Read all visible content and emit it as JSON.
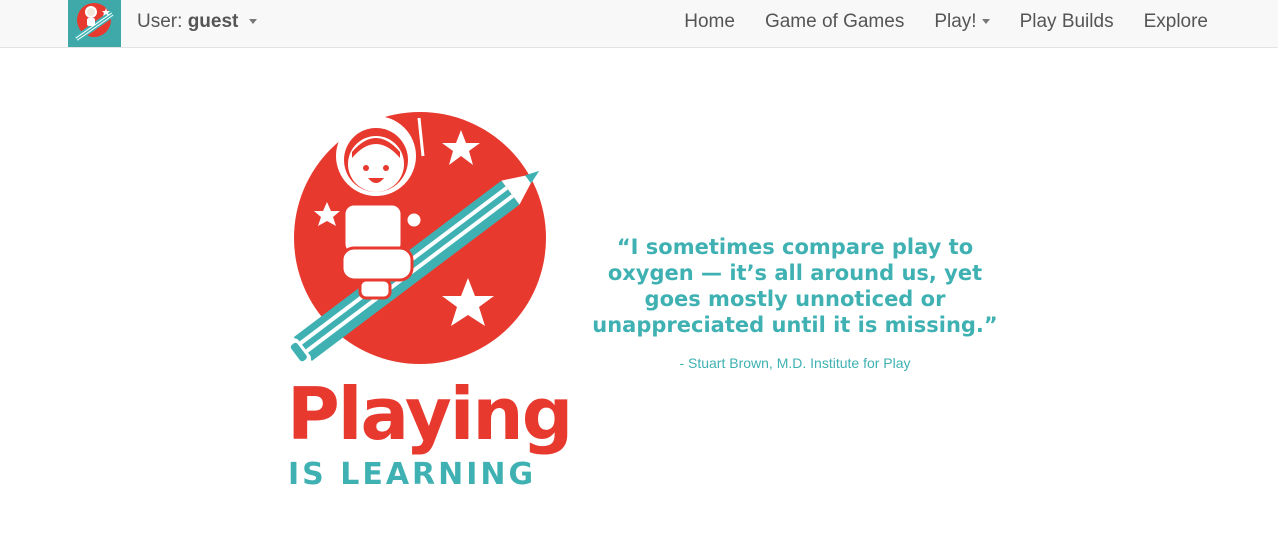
{
  "navbar": {
    "brand_logo_icon": "astronaut-rocket-logo-icon",
    "user_prefix": "User:",
    "user_name": "guest",
    "items": [
      {
        "label": "Home"
      },
      {
        "label": "Game of Games"
      },
      {
        "label": "Play!",
        "has_dropdown": true
      },
      {
        "label": "Play Builds"
      },
      {
        "label": "Explore"
      }
    ]
  },
  "hero": {
    "logo_icon": "astronaut-riding-pencil-rocket-icon",
    "logo_title": "Playing",
    "logo_subtitle": "IS LEARNING",
    "quote": "“I sometimes compare play to oxygen — it’s all around us, yet goes mostly unnoticed or unappreciated until it is missing.”",
    "quote_author": "- Stuart Brown, M.D. Institute for Play"
  },
  "colors": {
    "brand_red": "#e8392f",
    "brand_teal": "#3fb1b2",
    "navbar_bg": "#f8f8f8",
    "nav_text": "#555555"
  }
}
